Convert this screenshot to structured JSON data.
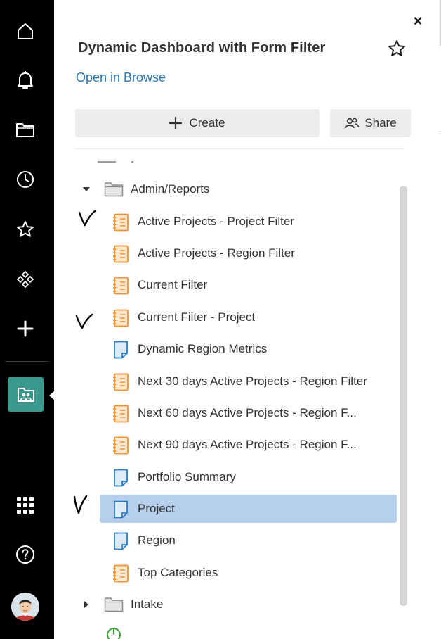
{
  "rail": {
    "items": [
      {
        "name": "home-icon"
      },
      {
        "name": "bell-icon"
      },
      {
        "name": "folder-icon"
      },
      {
        "name": "clock-icon"
      },
      {
        "name": "star-icon"
      },
      {
        "name": "apps-diamond-icon"
      },
      {
        "name": "plus-icon"
      },
      {
        "name": "workspace-icon"
      },
      {
        "name": "grid-icon"
      },
      {
        "name": "help-icon"
      }
    ]
  },
  "panel": {
    "close": "×",
    "title": "Dynamic Dashboard with Form Filter",
    "browse_link": "Open in Browse",
    "create_label": "Create",
    "share_label": "Share"
  },
  "tree": {
    "folders": [
      {
        "label": "Admin/Reports",
        "expanded": true
      },
      {
        "label": "Intake",
        "expanded": false
      }
    ],
    "items": [
      {
        "label": "Active Projects - Project Filter",
        "type": "report",
        "checked": true
      },
      {
        "label": "Active Projects - Region Filter",
        "type": "report",
        "checked": false
      },
      {
        "label": "Current Filter",
        "type": "report",
        "checked": false
      },
      {
        "label": "Current Filter - Project",
        "type": "report",
        "checked": true
      },
      {
        "label": "Dynamic Region Metrics",
        "type": "sheet",
        "checked": false
      },
      {
        "label": "Next 30 days Active Projects - Region Filter",
        "type": "report",
        "checked": false
      },
      {
        "label": "Next 60 days Active Projects - Region F...",
        "type": "report",
        "checked": false
      },
      {
        "label": "Next 90 days Active Projects - Region F...",
        "type": "report",
        "checked": false
      },
      {
        "label": "Portfolio Summary",
        "type": "sheet",
        "checked": false
      },
      {
        "label": "Project",
        "type": "sheet",
        "checked": true,
        "selected": true
      },
      {
        "label": "Region",
        "type": "sheet",
        "checked": false
      },
      {
        "label": "Top Categories",
        "type": "report",
        "checked": false
      }
    ]
  },
  "colors": {
    "rail_bg": "#000000",
    "active_tile": "#3b9a8e",
    "link": "#2775b3",
    "report_icon": "#f0922b",
    "sheet_icon": "#2c7cc4",
    "selected_row": "#b6cfec"
  }
}
